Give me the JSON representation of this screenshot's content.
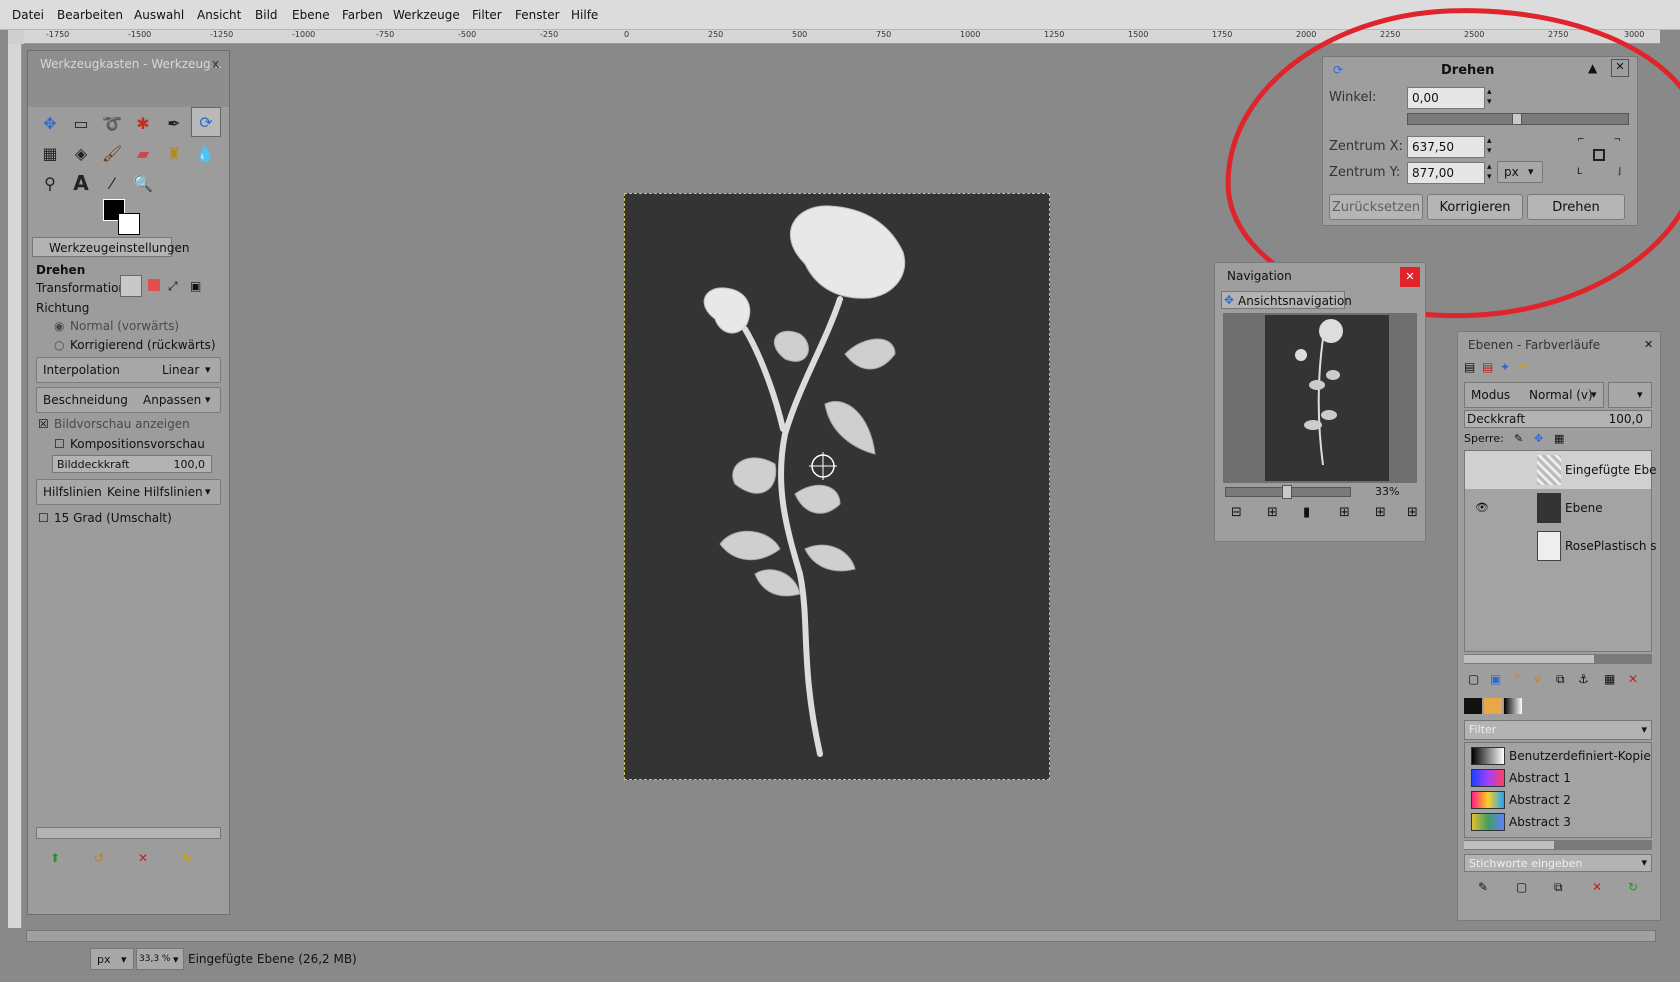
{
  "menu": [
    "Datei",
    "Bearbeiten",
    "Auswahl",
    "Ansicht",
    "Bild",
    "Ebene",
    "Farben",
    "Werkzeuge",
    "Filter",
    "Fenster",
    "Hilfe"
  ],
  "ruler_h": [
    "-1750",
    "-1500",
    "-1250",
    "-1000",
    "-750",
    "-500",
    "-250",
    "0",
    "250",
    "500",
    "750",
    "1000",
    "1250",
    "1500",
    "1750",
    "2000",
    "2250",
    "2500",
    "2750",
    "3000"
  ],
  "toolbox": {
    "title": "Werkzeugkasten - Werkzeug...",
    "close": "x",
    "options_tab": "Werkzeugeinstellungen",
    "tool_name": "Drehen",
    "transformation_label": "Transformation:",
    "richtung_label": "Richtung",
    "radio_normal": "Normal (vorwärts)",
    "radio_korrigierend": "Korrigierend (rückwärts)",
    "interpolation_label": "Interpolation",
    "interpolation_value": "Linear",
    "beschneidung_label": "Beschneidung",
    "beschneidung_value": "Anpassen",
    "bildvorschau": "Bildvorschau anzeigen",
    "kompositionsvorschau": "Kompositionsvorschau",
    "bilddeckkraft_label": "Bilddeckkraft",
    "bilddeckkraft_value": "100,0",
    "hilfslinien_label": "Hilfslinien",
    "hilfslinien_value": "Keine Hilfslinien",
    "grad15": "15 Grad (Umschalt)"
  },
  "drehen": {
    "title": "Drehen",
    "winkel_label": "Winkel:",
    "winkel_value": "0,00",
    "zx_label": "Zentrum X:",
    "zx_value": "637,50",
    "zy_label": "Zentrum Y:",
    "zy_value": "877,00",
    "unit": "px",
    "btn_reset": "Zurücksetzen",
    "btn_korrigieren": "Korrigieren",
    "btn_drehen": "Drehen"
  },
  "navigation": {
    "title": "Navigation",
    "tab": "Ansichtsnavigation",
    "zoom": "33%"
  },
  "layers": {
    "title": "Ebenen - Farbverläufe",
    "modus_label": "Modus",
    "modus_value": "Normal (v)",
    "deckkraft_label": "Deckkraft",
    "deckkraft_value": "100,0",
    "sperre_label": "Sperre:",
    "items": [
      "Eingefügte Ebe",
      "Ebene",
      "RosePlastisch s"
    ],
    "filter_placeholder": "Filter",
    "gradients": [
      "Benutzerdefiniert-Kopie",
      "Abstract 1",
      "Abstract 2",
      "Abstract 3"
    ],
    "tags_placeholder": "Stichworte eingeben"
  },
  "status": {
    "unit": "px",
    "zoom": "33,3 %",
    "message": "Eingefügte Ebene (26,2 MB)"
  }
}
